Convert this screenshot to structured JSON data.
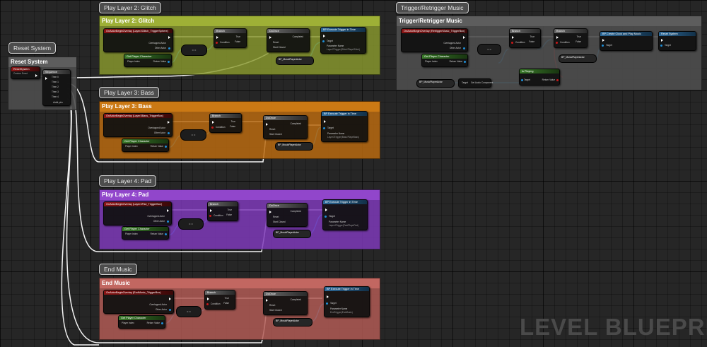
{
  "groups": {
    "glitch": {
      "bubble": "Play Layer 2: Glitch",
      "title": "Play Layer 2: Glitch",
      "event": "OnActorBeginOverlay (Layer2Glitch_TriggerSphere)",
      "var": "BP_MusicPlayerActor",
      "param": "Layer2Trigger(Glitch/PlayeGlitch)"
    },
    "bass": {
      "bubble": "Play Layer 3: Bass",
      "title": "Play Layer 3: Bass",
      "event": "OnActorBeginOverlay (Layer3Bass_TriggerBox)",
      "var": "BP_MusicPlayerActor",
      "param": "Layer3Trigger(Bass/PlayeBass)"
    },
    "pad": {
      "bubble": "Play Layer 4: Pad",
      "title": "Play Layer 4: Pad",
      "event": "OnActorBeginOverlay (Layer4Pad_TriggerBox)",
      "var": "BP_MusicPlayerActor",
      "param": "Layer4Trigger(Pad/PlayePad)"
    },
    "end": {
      "bubble": "End Music",
      "title": "End Music",
      "event": "OnActorBeginOverlay (EndMusic_TriggerBox)",
      "var": "BP_MusicPlayerActor",
      "param": "EndTrigger(EndMusic)"
    },
    "reset": {
      "bubble": "Reset System",
      "title": "Reset System",
      "event": "ResetSystem",
      "event_sub": "Custom Event",
      "seq": "Sequence",
      "add_pin": "Add pin"
    },
    "trigger": {
      "bubble": "Trigger/Retrigger Music",
      "title": "Trigger/Retrigger Music",
      "event": "OnActorBeginOverlay (RetriggerMusic_TriggerBox)",
      "var": "BP_MusicPlayerActor",
      "fn_start": "BP Create Clock and Play Music",
      "fn_reset": "Reset System",
      "is_playing": "Is Playing",
      "get_audio": "Get Audio Component",
      "audio_target": "Target",
      "audio_rv": "Return Value"
    }
  },
  "labels": {
    "doonce": "DoOnce",
    "branch": "Branch",
    "get_player": "Get Player Character",
    "player_index": "Player Index",
    "return_value": "Return Value",
    "overlapped": "Overlapped Actor",
    "other": "Other Actor",
    "true": "True",
    "false": "False",
    "condition": "Condition",
    "reset": "Reset",
    "start_closed": "Start Closed",
    "completed": "Completed",
    "execute": "BP Execute Trigger in Time",
    "target": "Target",
    "param_name": "Parameter Name",
    "then_0": "Then 0",
    "then_1": "Then 1",
    "then_2": "Then 2",
    "then_3": "Then 3",
    "then_4": "Then 4",
    "eq": "= ="
  },
  "watermark": "LEVEL BLUEPRINT",
  "colors": {
    "glitch": "#8a9a2e",
    "bass": "#b86a10",
    "pad": "#7e3ab8",
    "end": "#b05a55",
    "reset": "#4e4e4e",
    "trigger": "#4e4e4e"
  }
}
